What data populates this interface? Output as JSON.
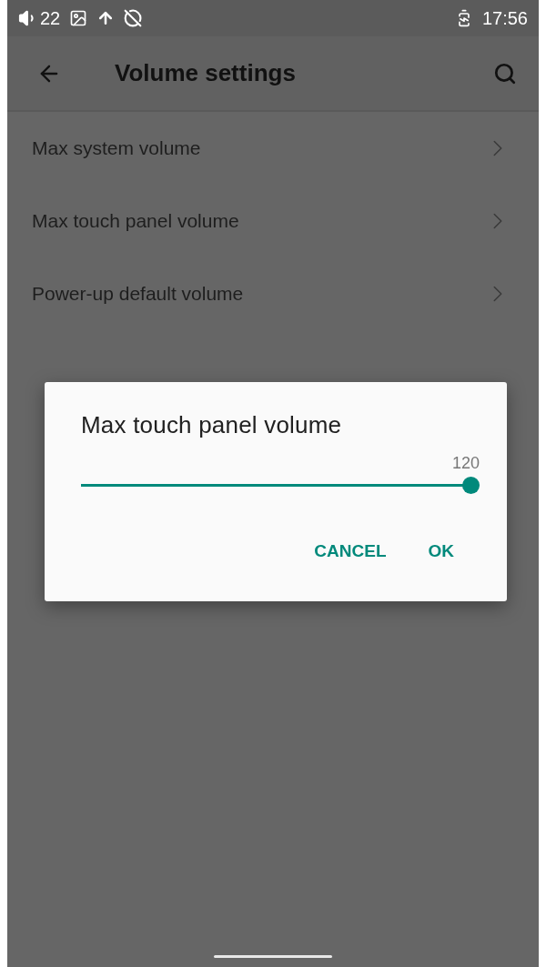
{
  "status_bar": {
    "volume": "22",
    "time": "17:56"
  },
  "app_bar": {
    "title": "Volume settings"
  },
  "items": [
    {
      "label": "Max system volume"
    },
    {
      "label": "Max touch panel volume"
    },
    {
      "label": "Power-up default volume"
    }
  ],
  "dialog": {
    "title": "Max touch panel volume",
    "reading": "120",
    "level": 1,
    "buttons": [
      "CANCEL",
      "OK"
    ]
  }
}
